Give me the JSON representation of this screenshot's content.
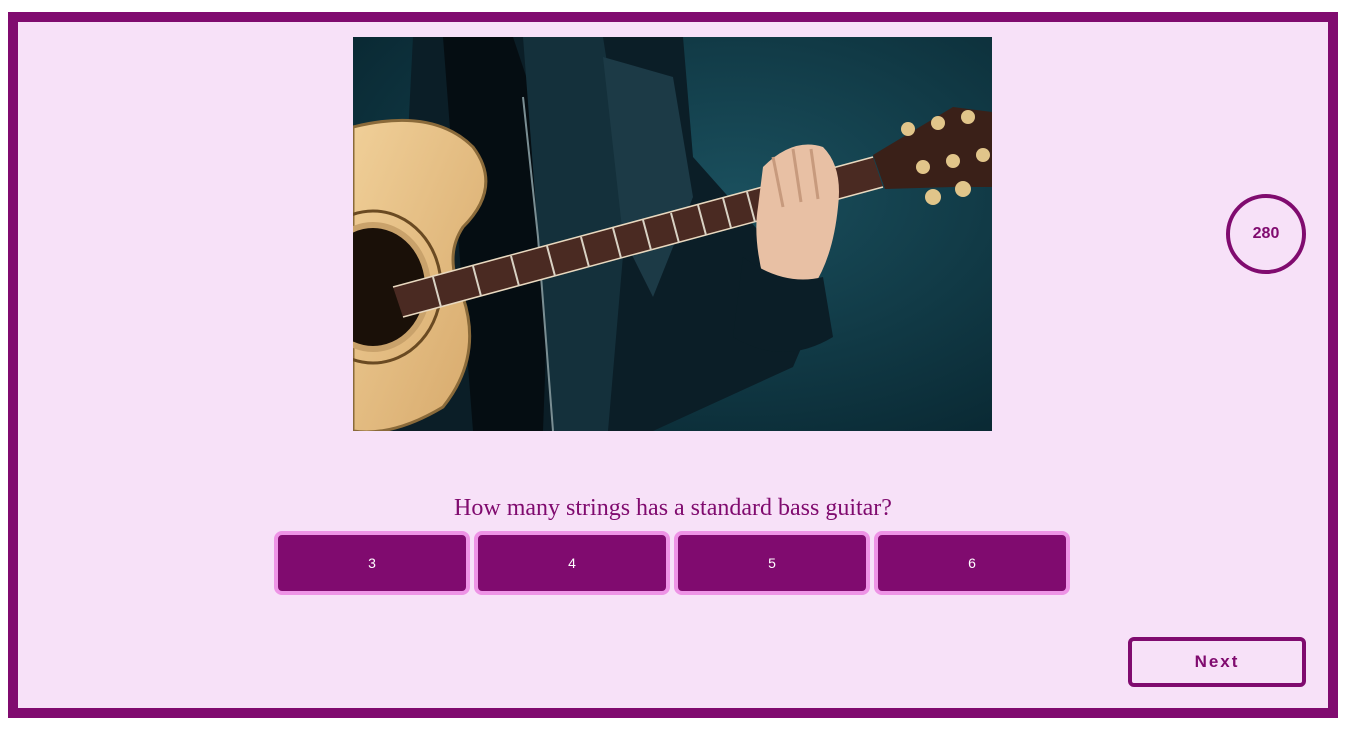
{
  "quiz": {
    "timer_value": "280",
    "question": "How many strings has a standard bass guitar?",
    "answers": [
      {
        "label": "3"
      },
      {
        "label": "4"
      },
      {
        "label": "5"
      },
      {
        "label": "6"
      }
    ],
    "next_label": "Next",
    "image": {
      "subject-icon": "acoustic-guitar-photo"
    }
  },
  "colors": {
    "frame": "#800b6f",
    "background": "#f7e1f8",
    "answer_fill": "#800b6f",
    "answer_border": "#ee94e6",
    "answer_text": "#ffffff"
  }
}
